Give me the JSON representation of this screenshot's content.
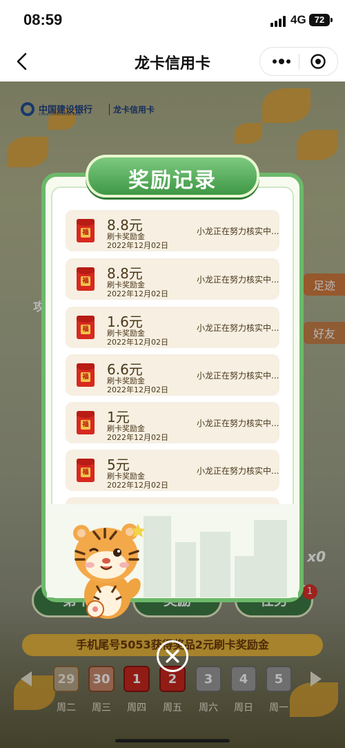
{
  "status_bar": {
    "time": "08:59",
    "network": "4G",
    "battery": "72"
  },
  "navbar": {
    "title": "龙卡信用卡",
    "back_icon": "chevron-left-icon",
    "more_icon": "more-dots-icon",
    "close_icon": "target-icon"
  },
  "background": {
    "bank_name": "中国建设银行",
    "bank_name_en": "China Construction Bank",
    "card_brand": "龙卡信用卡",
    "side_labels": [
      "足迹",
      "好友"
    ],
    "left_label": "攻",
    "multiplier": "x0",
    "bottom_buttons": [
      "第十",
      "奖励",
      "任务"
    ],
    "task_badge": "1",
    "ticker": "手机尾号5053获得奖品2元刷卡奖励金",
    "days": [
      {
        "num": "29",
        "name": "周二",
        "state": "past"
      },
      {
        "num": "30",
        "name": "周三",
        "state": "past-red"
      },
      {
        "num": "1",
        "name": "周四",
        "state": "red"
      },
      {
        "num": "2",
        "name": "周五",
        "state": "red"
      },
      {
        "num": "3",
        "name": "周六",
        "state": "gray"
      },
      {
        "num": "4",
        "name": "周日",
        "state": "gray"
      },
      {
        "num": "5",
        "name": "周一",
        "state": "gray"
      }
    ]
  },
  "modal": {
    "title": "奖励记录",
    "records": [
      {
        "amount": "8.8元",
        "type": "刷卡奖励金",
        "date": "2022年12月02日",
        "status": "小龙正在努力核实中..."
      },
      {
        "amount": "8.8元",
        "type": "刷卡奖励金",
        "date": "2022年12月02日",
        "status": "小龙正在努力核实中..."
      },
      {
        "amount": "1.6元",
        "type": "刷卡奖励金",
        "date": "2022年12月02日",
        "status": "小龙正在努力核实中..."
      },
      {
        "amount": "6.6元",
        "type": "刷卡奖励金",
        "date": "2022年12月02日",
        "status": "小龙正在努力核实中..."
      },
      {
        "amount": "1元",
        "type": "刷卡奖励金",
        "date": "2022年12月02日",
        "status": "小龙正在努力核实中..."
      },
      {
        "amount": "5元",
        "type": "刷卡奖励金",
        "date": "2022年12月02日",
        "status": "小龙正在努力核实中..."
      }
    ],
    "envelope_char": "福",
    "close_icon": "close-circle-icon",
    "mascot": "tiger-mascot"
  },
  "colors": {
    "accent_green": "#6cb86a",
    "card_bg": "#f6efe2",
    "envelope_red": "#d7291f"
  }
}
